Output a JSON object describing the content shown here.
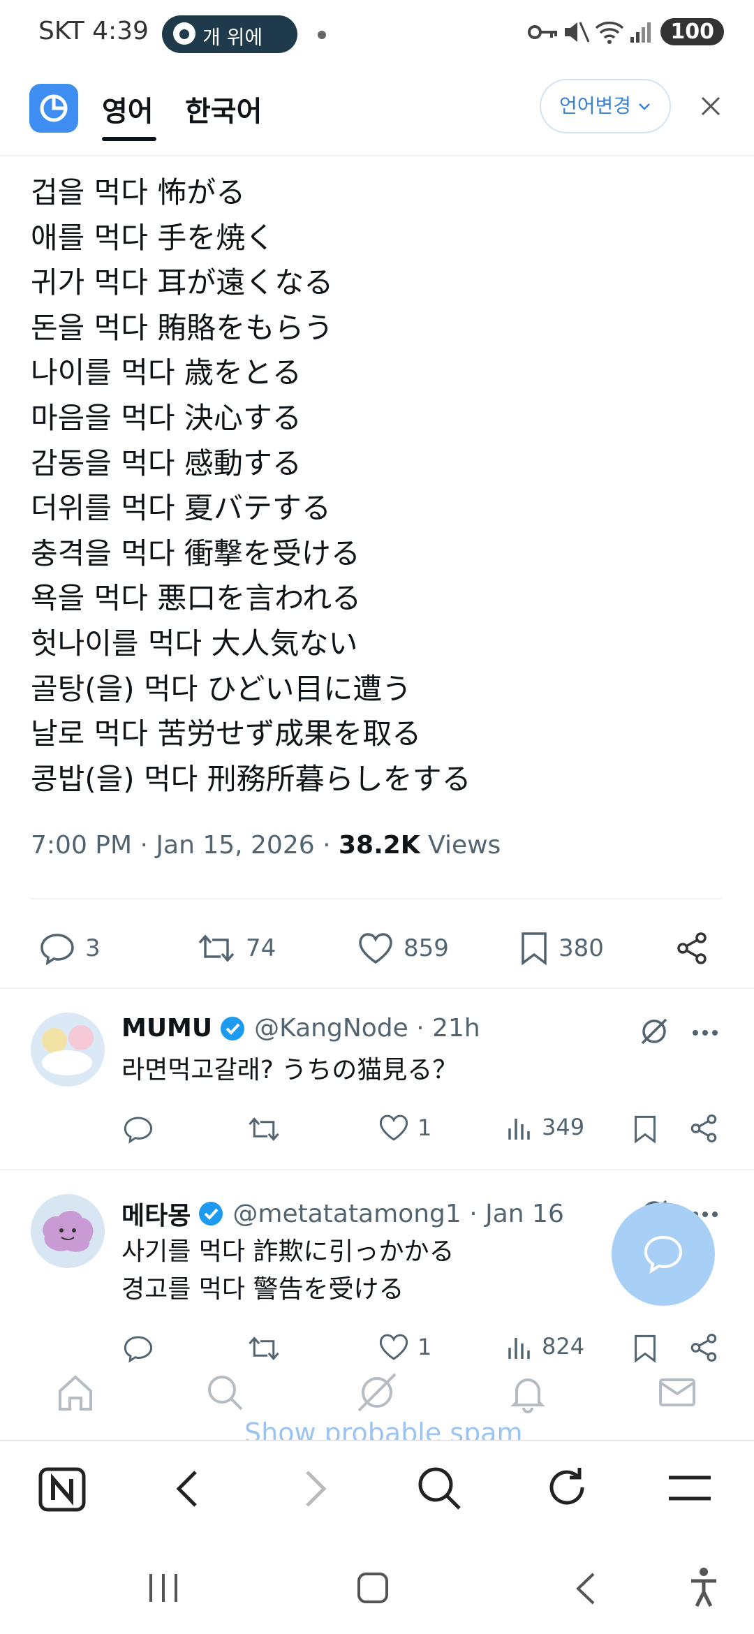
{
  "status_bar": {
    "carrier_time": "SKT 4:39",
    "pill_text": "개 위에",
    "battery": "100"
  },
  "translate_header": {
    "tab_source": "영어",
    "tab_target": "한국어",
    "change_language": "언어변경"
  },
  "tweet": {
    "lines": [
      "겁을 먹다 怖がる",
      "애를 먹다 手を焼く",
      "귀가 먹다 耳が遠くなる",
      "돈을 먹다 賄賂をもらう",
      "나이를 먹다 歳をとる",
      "마음을 먹다 決心する",
      "감동을 먹다 感動する",
      "더위를 먹다 夏バテする",
      "충격을 먹다 衝撃を受ける",
      "욕을 먹다 悪口を言われる",
      "헛나이를 먹다 大人気ない",
      "골탕(을) 먹다 ひどい目に遭う",
      "날로 먹다  苦労せず成果を取る",
      "콩밥(을) 먹다 刑務所暮らしをする"
    ],
    "meta_time": "7:00 PM · Jan 15, 2026 · ",
    "views_count": "38.2K",
    "views_label": " Views",
    "replies": "3",
    "retweets": "74",
    "likes": "859",
    "bookmarks": "380"
  },
  "replies": [
    {
      "name": "MUMU",
      "handle": "@KangNode · 21h",
      "text_lines": [
        "라면먹고갈래? うちの猫見る？"
      ],
      "likes": "1",
      "views": "349"
    },
    {
      "name": "메타몽",
      "handle": "@metatatamong1 · Jan 16",
      "text_lines": [
        "사기를 먹다 詐欺に引っかかる",
        "경고를 먹다  警告を受ける"
      ],
      "likes": "1",
      "views": "824"
    }
  ],
  "bottom": {
    "spam_link": "Show probable spam"
  },
  "colors": {
    "accent": "#1d9bf0",
    "fab": "#a8d0f7",
    "logo": "#3d8ef0"
  }
}
